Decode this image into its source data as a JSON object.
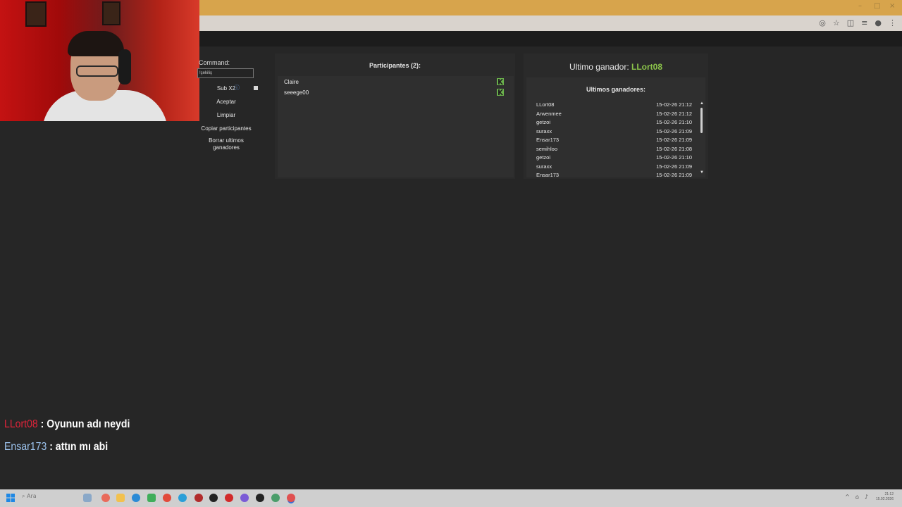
{
  "browser": {
    "window_controls": [
      "–",
      "□",
      "×"
    ],
    "toolbar_icons": [
      "eye-off-icon",
      "star-icon",
      "extensions-icon",
      "menu-icon",
      "profile-icon",
      "more-icon"
    ]
  },
  "control_panel": {
    "command_label": "Command:",
    "command_value": "!çekiliş",
    "sub_label": "Sub X2",
    "sub_toggle_icon": "info-icon",
    "sub_checked": true,
    "accept_label": "Aceptar",
    "clear_label": "Limpiar",
    "copy_label": "Copiar participantes",
    "delete_label": "Borrar ultimos ganadores"
  },
  "participants": {
    "title": "Participantes (2):",
    "items": [
      {
        "name": "Claire",
        "action_icon": "kick-icon"
      },
      {
        "name": "seeege00",
        "action_icon": "kick-icon"
      }
    ]
  },
  "winner": {
    "label": "Ultimo ganador:",
    "name": "LLort08",
    "name_color": "#8bc34a"
  },
  "last_winners": {
    "title": "Ultimos ganadores:",
    "rows": [
      {
        "name": "LLort08",
        "time": "15-02-26 21:12"
      },
      {
        "name": "Arwenmee",
        "time": "15-02-26 21:12"
      },
      {
        "name": "getzoi",
        "time": "15-02-26 21:10"
      },
      {
        "name": "suraxx",
        "time": "15-02-26 21:09"
      },
      {
        "name": "Ensar173",
        "time": "15-02-26 21:09"
      },
      {
        "name": "semihloo",
        "time": "15-02-26 21:08"
      },
      {
        "name": "getzoi",
        "time": "15-02-26 21:10"
      },
      {
        "name": "suraxx",
        "time": "15-02-26 21:09"
      },
      {
        "name": "Ensar173",
        "time": "15-02-26 21:09"
      }
    ]
  },
  "chat": [
    {
      "user": "LLort08",
      "sep": " : ",
      "message": "Oyunun adı neydi",
      "user_color": "#e0243a"
    },
    {
      "user": "Ensar173",
      "sep": " : ",
      "message": "attın mı abi",
      "user_color": "#9ec5f0"
    }
  ],
  "taskbar": {
    "search_placeholder": "Ara",
    "clock_time": "21:12",
    "clock_date": "15.02.2026"
  }
}
